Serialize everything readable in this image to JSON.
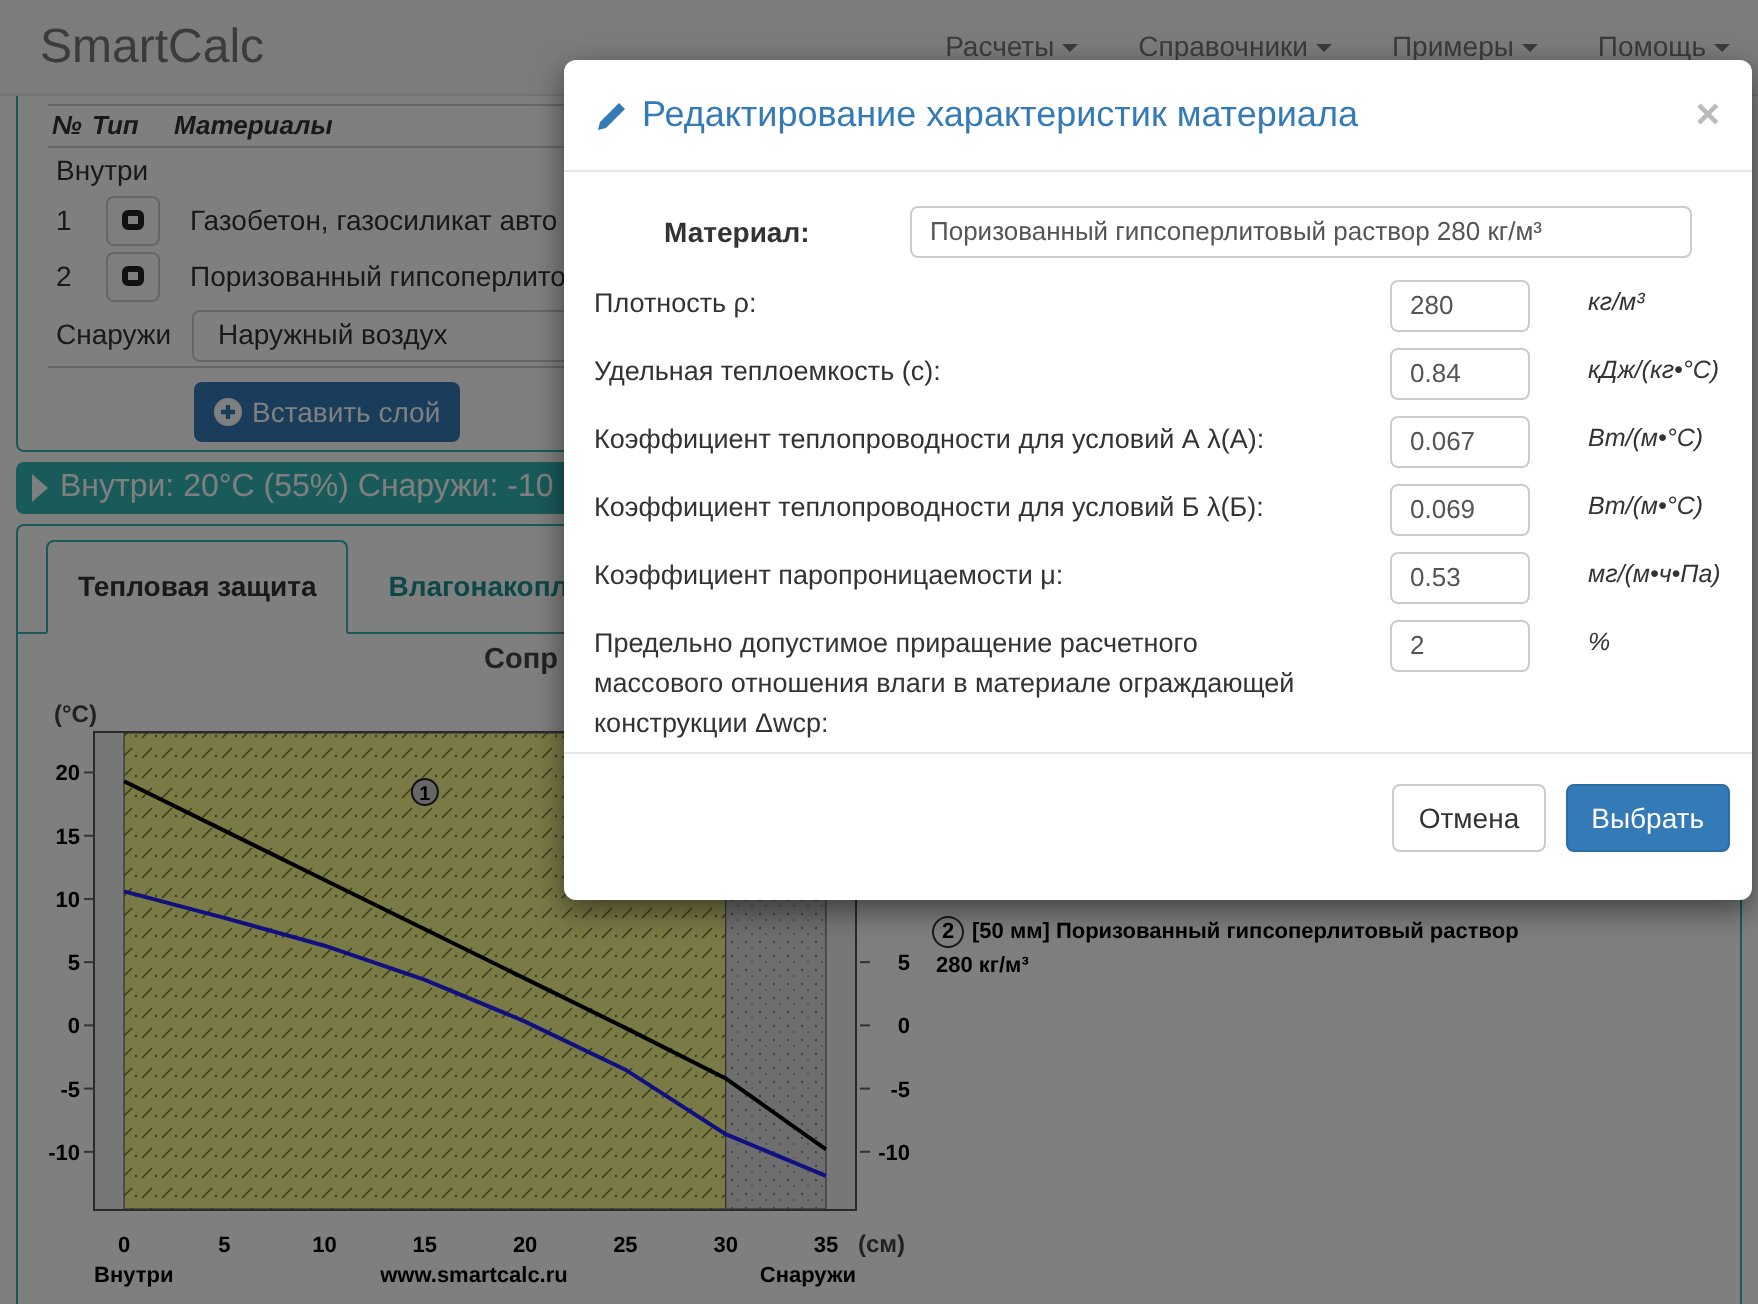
{
  "brand": "SmartCalc",
  "nav": [
    {
      "label": "Расчеты"
    },
    {
      "label": "Справочники"
    },
    {
      "label": "Примеры"
    },
    {
      "label": "Помощь"
    }
  ],
  "layers_table": {
    "columns": [
      "№",
      "Тип",
      "Материалы"
    ],
    "inside_label": "Внутри",
    "rows": [
      {
        "number": "1",
        "material": "Газобетон, газосиликат авто"
      },
      {
        "number": "2",
        "material": "Поризованный гипсоперлито"
      }
    ],
    "outside_label": "Снаружи",
    "outside_select": "Наружный воздух",
    "insert_button": "Вставить слой"
  },
  "summary_bar": "Внутри: 20°C (55%) Снаружи: -10",
  "tabs": [
    {
      "label": "Тепловая защита",
      "selected": true
    },
    {
      "label": "Влагонакопл",
      "selected": false
    }
  ],
  "chart_title": "Сопр",
  "chart": {
    "y_unit": "(°C)",
    "x_unit": "(см)",
    "left_caption": "Внутри",
    "center_caption": "www.smartcalc.ru",
    "right_caption": "Снаружи",
    "layer_marker": "1",
    "right_ticks": [
      "5",
      "0",
      "-5",
      "-10"
    ],
    "chart_data": {
      "type": "line",
      "x": [
        0,
        5,
        10,
        15,
        20,
        25,
        30,
        35
      ],
      "xlim": [
        -1.5,
        36.5
      ],
      "ylim": [
        -14.6,
        23.2
      ],
      "xticks": [
        0,
        5,
        10,
        15,
        20,
        25,
        30,
        35
      ],
      "yticks": [
        -10,
        -5,
        0,
        5,
        10,
        15,
        20
      ],
      "series": [
        {
          "color": "#000000",
          "values": [
            19.3,
            15.4,
            11.5,
            7.6,
            3.7,
            -0.2,
            -4.2,
            -9.8
          ]
        },
        {
          "color": "#101080",
          "values": [
            10.6,
            8.5,
            6.3,
            3.6,
            0.3,
            -3.5,
            -8.6,
            -11.9
          ]
        }
      ]
    }
  },
  "legend": [
    {
      "marker": "2",
      "text": "[50 мм] Поризованный гипсоперлитовый раствор",
      "text_line_2": "280 кг/м³"
    }
  ],
  "dialog": {
    "title": "Редактирование характеристик материала",
    "close": "×",
    "material_label": "Материал:",
    "material_value": "Поризованный гипсоперлитовый раствор 280 кг/м³",
    "fields": [
      {
        "label": "Плотность ρ:",
        "value": "280",
        "unit": "кг/м³"
      },
      {
        "label": "Удельная теплоемкость (c):",
        "value": "0.84",
        "unit": "кДж/(кг•°C)"
      },
      {
        "label": "Коэффициент теплопроводности для условий А λ(А):",
        "value": "0.067",
        "unit": "Вт/(м•°C)"
      },
      {
        "label": "Коэффициент теплопроводности для условий Б λ(Б):",
        "value": "0.069",
        "unit": "Вт/(м•°C)"
      },
      {
        "label": "Коэффициент паропроницаемости μ:",
        "value": "0.53",
        "unit": "мг/(м•ч•Па)"
      },
      {
        "label": "Предельно допустимое приращение расчетного массового отношения влаги в материале ограждающей конструкции Δwср:",
        "value": "2",
        "unit": "%"
      }
    ],
    "buttons": [
      {
        "label": "Отмена",
        "kind": "default"
      },
      {
        "label": "Выбрать",
        "kind": "primary"
      }
    ]
  }
}
